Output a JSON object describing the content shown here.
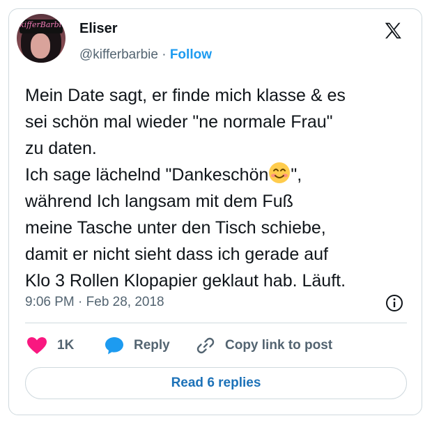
{
  "author": {
    "display_name": "Eliser",
    "handle": "@kifferbarbie",
    "separator": " · ",
    "follow_label": "Follow",
    "avatar_cap_text": "kifferBarbie"
  },
  "tweet": {
    "text": "Mein Date sagt, er finde mich klasse & es\nsei schön mal wieder \"ne normale Frau\"\nzu daten.\nIch sage lächelnd \"Dankeschön",
    "text_after_emoji": "\",\nwährend Ich langsam mit dem Fuß\nmeine Tasche unter den Tisch schiebe,\ndamit er nicht sieht dass ich gerade auf\nKlo 3 Rollen Klopapier geklaut hab. Läuft.",
    "emoji_icon": "smiling-face-with-smiling-eyes-icon",
    "timestamp": "9:06 PM · Feb 28, 2018"
  },
  "actions": {
    "like_count": "1K",
    "reply_label": "Reply",
    "copy_link_label": "Copy link to post"
  },
  "read_replies_label": "Read 6 replies",
  "colors": {
    "accent": "#1d9bf0",
    "like": "#f91880",
    "secondary_text": "#536471",
    "border": "#cfd9de"
  }
}
